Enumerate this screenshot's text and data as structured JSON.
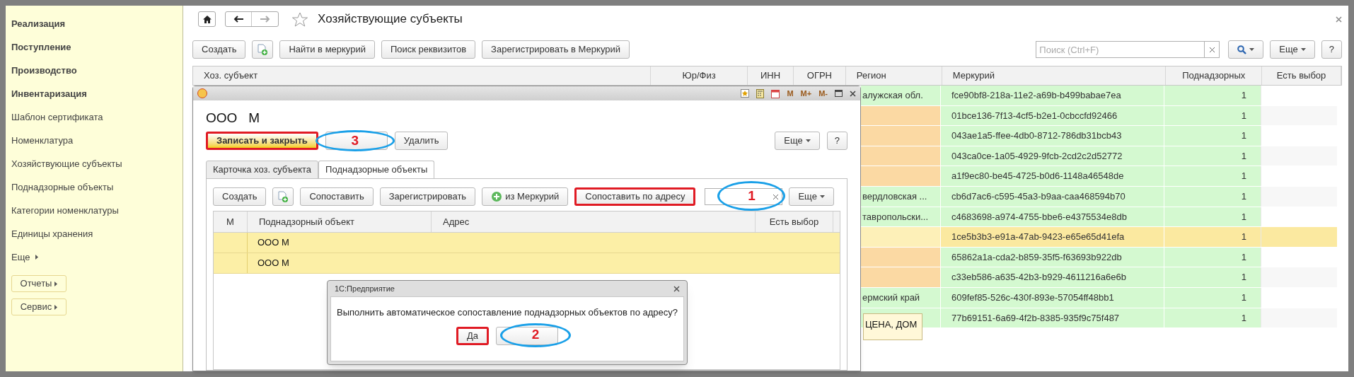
{
  "sidebar": {
    "items": [
      {
        "label": "Реализация",
        "kind": "section"
      },
      {
        "label": "Поступление",
        "kind": "section"
      },
      {
        "label": "Производство",
        "kind": "section"
      },
      {
        "label": "Инвентаризация",
        "kind": "section"
      },
      {
        "label": "Шаблон сертификата",
        "kind": "link"
      },
      {
        "label": "Номенклатура",
        "kind": "link"
      },
      {
        "label": "Хозяйствующие субъекты",
        "kind": "link"
      },
      {
        "label": "Поднадзорные объекты",
        "kind": "link"
      },
      {
        "label": "Категории номенклатуры",
        "kind": "link"
      },
      {
        "label": "Единицы хранения",
        "kind": "link"
      },
      {
        "label": "Еще",
        "kind": "more"
      },
      {
        "label": "Отчеты",
        "kind": "button"
      },
      {
        "label": "Сервис",
        "kind": "button"
      }
    ]
  },
  "header": {
    "title": "Хозяйствующие субъекты",
    "back_enabled": true,
    "forward_enabled": false,
    "favorite": false
  },
  "toolbar": {
    "buttons": [
      {
        "label": "Создать",
        "kind": "text"
      },
      {
        "kind": "icon"
      },
      {
        "label": "Найти в меркурий",
        "kind": "text"
      },
      {
        "label": "Поиск реквизитов",
        "kind": "text"
      },
      {
        "label": "Зарегистрировать в Меркурий",
        "kind": "text"
      }
    ],
    "search": {
      "placeholder": "Поиск (Ctrl+F)"
    },
    "more": "Еще",
    "help": "?"
  },
  "table": {
    "columns": [
      "Хоз. субъект",
      "Юр/Физ",
      "ИНН",
      "ОГРН",
      "Регион",
      "Меркурий",
      "Поднадзорных",
      "Есть выбор"
    ],
    "rows": [
      {
        "region": "алужская обл.",
        "color": "#d4f9d0",
        "mercury": "fce90bf8-218a-11e2-a69b-b499babae7ea",
        "count": "1",
        "selected": false
      },
      {
        "color": "#fbd9a3",
        "mercury": "01bce136-7f13-4cf5-b2e1-0cbccfd92466",
        "count": "1",
        "selected": false
      },
      {
        "color": "#fbd9a3",
        "mercury": "043ae1a5-ffee-4db0-8712-786db31bcb43",
        "count": "1",
        "selected": false
      },
      {
        "color": "#fbd9a3",
        "mercury": "043ca0ce-1a05-4929-9fcb-2cd2c2d52772",
        "count": "1",
        "selected": false
      },
      {
        "color": "#fbd9a3",
        "mercury": "a1f9ec80-be45-4725-b0d6-1148a46548de",
        "count": "1",
        "selected": false
      },
      {
        "region": "вердловская ...",
        "color": "#d4f9d0",
        "mercury": "cb6d7ac6-c595-45a3-b9aa-caa468594b70",
        "count": "1",
        "selected": false
      },
      {
        "region": "тавропольски...",
        "color": "#d4f9d0",
        "mercury": "c4683698-a974-4755-bbe6-e4375534e8db",
        "count": "1",
        "selected": false
      },
      {
        "color": "#fdf0b8",
        "mercury": "1ce5b3b3-e91a-47ab-9423-e65e65d41efa",
        "count": "1",
        "selected": true
      },
      {
        "color": "#fbd9a3",
        "mercury": "65862a1a-cda2-b859-35f5-f63693b922db",
        "count": "1",
        "selected": false
      },
      {
        "color": "#fbd9a3",
        "mercury": "c33eb586-a635-42b3-b929-4611216a6e6b",
        "count": "1",
        "selected": false
      },
      {
        "region": "ермский край",
        "color": "#d4f9d0",
        "mercury": "609fef85-526c-430f-893e-57054ff48bb1",
        "count": "1",
        "selected": false
      },
      {
        "color": "#d4f9d0",
        "mercury": "77b69151-6a69-4f2b-8385-935f9c75f487",
        "count": "1",
        "selected": false
      }
    ],
    "tooltip": {
      "text": "ЦЕНА, ДОМ"
    }
  },
  "form": {
    "title_bar_buttons": [
      "M",
      "M+",
      "M-"
    ],
    "title": "ООО   М",
    "buttons": [
      {
        "label": "Записать и закрыть",
        "kind": "default",
        "highlighted": true
      },
      {
        "kind": "covered",
        "callout": "3"
      },
      {
        "label": "Удалить",
        "kind": "text",
        "highlighted": false
      }
    ],
    "more": "Еще",
    "help": "?",
    "tabs": [
      {
        "label": "Карточка хоз. субъекта",
        "selected": false
      },
      {
        "label": "Поднадзорные объекты",
        "selected": true
      }
    ],
    "toolbar": [
      {
        "label": "Создать",
        "kind": "text",
        "highlighted": false
      },
      {
        "kind": "icon"
      },
      {
        "label": "Сопоставить",
        "kind": "text",
        "highlighted": false
      },
      {
        "label": "Зарегистрировать",
        "kind": "text",
        "highlighted": false
      },
      {
        "label": "из Меркурий",
        "kind": "plus",
        "highlighted": false
      },
      {
        "label": "Сопоставить по адресу",
        "kind": "text",
        "highlighted": true
      }
    ],
    "search": {
      "callout": "1"
    },
    "toolbar_more": "Еще",
    "columns": [
      "М",
      "Поднадзорный объект",
      "Адрес",
      "Есть выбор"
    ],
    "rows": [
      {
        "object": "ООО М",
        "selected": true
      },
      {
        "object": "ООО М",
        "selected": true
      }
    ]
  },
  "confirm": {
    "title": "1С:Предприятие",
    "message": "Выполнить автоматическое сопоставление поднадзорных объектов по адресу?",
    "buttons": [
      {
        "label": "Да",
        "kind": "text",
        "highlighted": true
      },
      {
        "kind": "covered",
        "callout": "2"
      }
    ]
  }
}
